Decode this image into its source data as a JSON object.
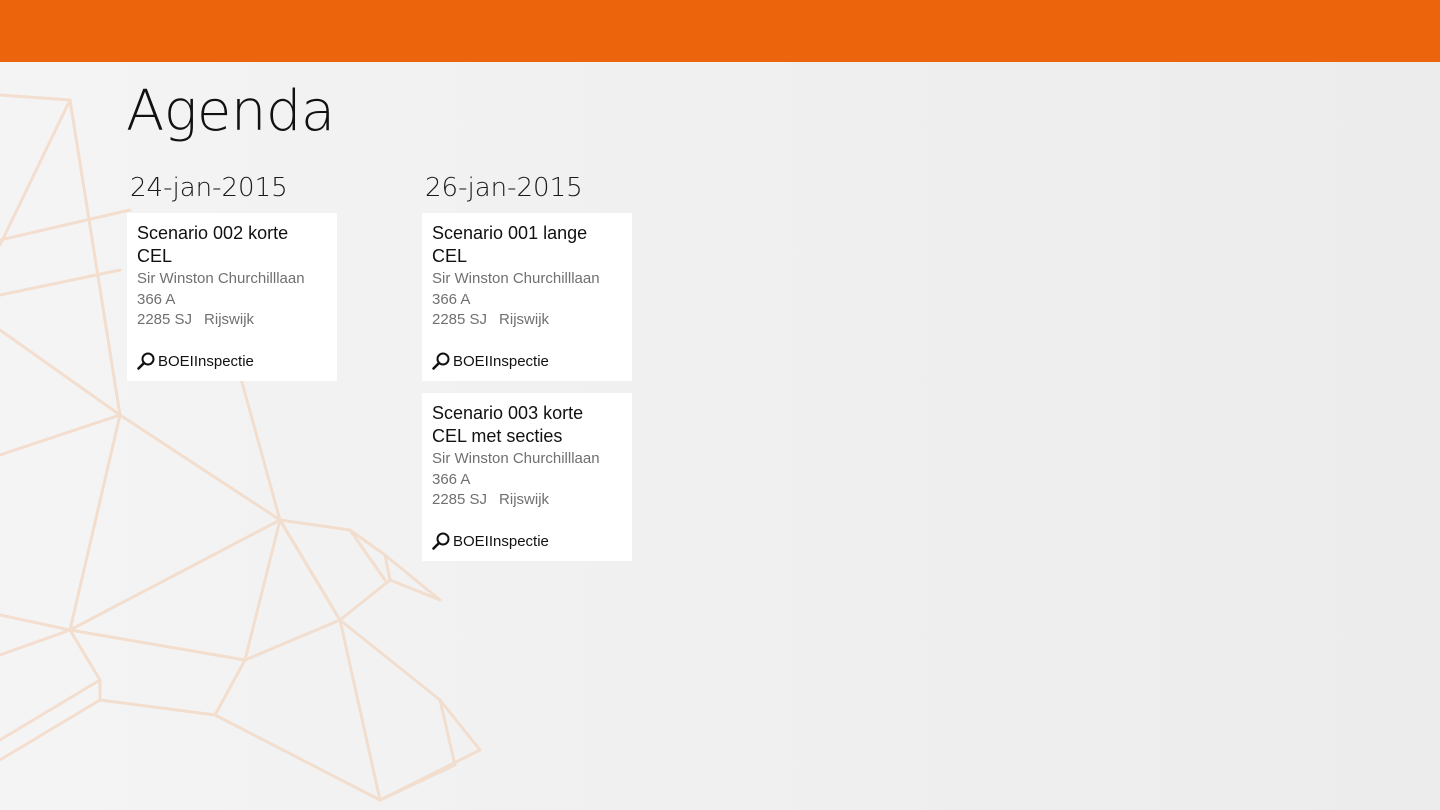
{
  "app": {
    "title": "Agenda",
    "accent_color": "#ec640c"
  },
  "days": [
    {
      "date": "24-jan-2015",
      "items": [
        {
          "title": "Scenario 002 korte CEL",
          "street": "Sir Winston Churchilllaan",
          "number": "366 A",
          "postcode": "2285 SJ",
          "city": "Rijswijk",
          "inspection_type": "BOEIInspectie",
          "icon": "search-icon"
        }
      ]
    },
    {
      "date": "26-jan-2015",
      "items": [
        {
          "title": "Scenario 001 lange CEL",
          "street": "Sir Winston Churchilllaan",
          "number": "366 A",
          "postcode": "2285 SJ",
          "city": "Rijswijk",
          "inspection_type": "BOEIInspectie",
          "icon": "search-icon"
        },
        {
          "title": "Scenario 003 korte CEL met secties",
          "street": "Sir Winston Churchilllaan",
          "number": "366 A",
          "postcode": "2285 SJ",
          "city": "Rijswijk",
          "inspection_type": "BOEIInspectie",
          "icon": "search-icon"
        }
      ]
    }
  ]
}
